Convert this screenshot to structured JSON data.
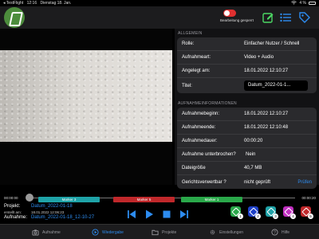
{
  "status_bar": {
    "app": "◂ TestFlight",
    "time": "12:16",
    "date": "Dienstag 18. Jan.",
    "wifi": "wifi-icon",
    "battery_pct": "4 %"
  },
  "header": {
    "lock_toggle_label": "Bearbeitung gesperrt",
    "lock_toggle_on": true,
    "icons": [
      "edit-icon",
      "list-icon",
      "tags-icon"
    ],
    "accent": "#4cd964"
  },
  "panel": {
    "general_title": "ALLGEMEIN",
    "general_rows": [
      {
        "key": "Rolle:",
        "value": "Einfacher Nutzer / Schnell"
      },
      {
        "key": "Aufnahmeart:",
        "value": "Video + Audio"
      },
      {
        "key": "Angelegt am:",
        "value": "18.01.2022 12:10:27"
      }
    ],
    "title_label": "Titel:",
    "title_value": "Datum_2022-01-1...",
    "rec_title": "AUFNAHMEINFORMATIONEN",
    "rec_rows": [
      {
        "key": "Aufnahmebeginn:",
        "value": "18.01.2022 12:10:27"
      },
      {
        "key": "Aufnahmeende:",
        "value": "18.01.2022 12:10:48"
      },
      {
        "key": "Aufnahmedauer:",
        "value": "00:00:20"
      },
      {
        "key": "Aufnahme unterbrochen?",
        "value": "Nein"
      },
      {
        "key": "Dateigröße",
        "value": "40,7 MB"
      }
    ],
    "court_key": "Gerichtsverwertbar ?",
    "court_value": "nicht geprüft",
    "check_link": "Prüfen"
  },
  "timeline": {
    "start": "00:00:00",
    "end": "00:00:20",
    "progress": 0.0,
    "markers": [
      {
        "label": "Marker 3",
        "color": "#1fa3a8"
      },
      {
        "label": "Marker 5",
        "color": "#c0282b"
      },
      {
        "label": "Marker 1",
        "color": "#2aa84a"
      }
    ]
  },
  "info": {
    "project_label": "Projekt:",
    "project_value": "Datum_2022-01-18",
    "created_label": "erstellt am:",
    "created_value": "18.01.2022 12:06:23",
    "recording_label": "Aufnahme:",
    "recording_value": "Datum_2022-01-18_12-10-27"
  },
  "controls": [
    "skip-back-icon",
    "play-icon",
    "stop-icon",
    "skip-forward-icon"
  ],
  "marker_buttons": [
    {
      "num": "1",
      "color": "#2aa84a"
    },
    {
      "num": "2",
      "color": "#1e40c8"
    },
    {
      "num": "3",
      "color": "#1fa3a8"
    },
    {
      "num": "4",
      "color": "#c02ec0"
    },
    {
      "num": "5",
      "color": "#c0282b"
    }
  ],
  "tabs": [
    {
      "label": "Aufnahme",
      "icon": "camera-icon",
      "active": false
    },
    {
      "label": "Wiedergabe",
      "icon": "play-circle-icon",
      "active": true
    },
    {
      "label": "Projekte",
      "icon": "folder-icon",
      "active": false
    },
    {
      "label": "Einstellungen",
      "icon": "gear-icon",
      "active": false
    },
    {
      "label": "Hilfe",
      "icon": "help-icon",
      "active": false
    }
  ]
}
